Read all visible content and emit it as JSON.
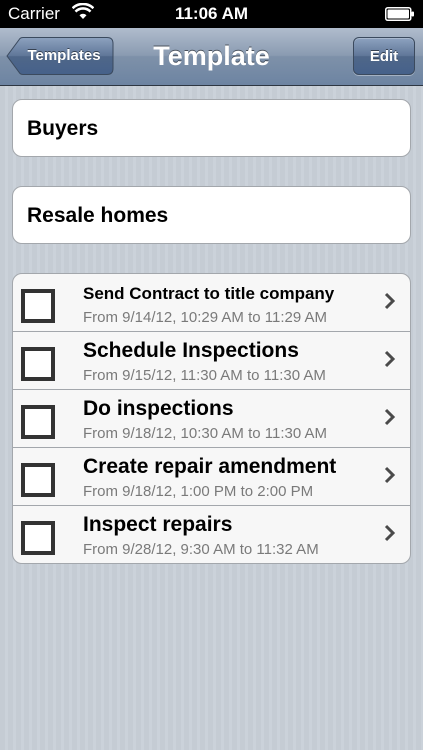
{
  "status_bar": {
    "carrier": "Carrier",
    "time": "11:06 AM",
    "wifi_icon": "wifi-icon",
    "battery_icon": "battery-icon"
  },
  "nav": {
    "back_label": "Templates",
    "title": "Template",
    "edit_label": "Edit"
  },
  "fields": {
    "name": "Buyers",
    "category": "Resale homes"
  },
  "tasks": [
    {
      "title": "Send Contract to title company",
      "subtitle": "From 9/14/12, 10:29 AM to 11:29 AM",
      "checked": false
    },
    {
      "title": "Schedule Inspections",
      "subtitle": "From 9/15/12, 11:30 AM to 11:30 AM",
      "checked": false
    },
    {
      "title": "Do inspections",
      "subtitle": "From 9/18/12, 10:30 AM to 11:30 AM",
      "checked": false
    },
    {
      "title": "Create repair amendment",
      "subtitle": "From 9/18/12, 1:00 PM to 2:00 PM",
      "checked": false
    },
    {
      "title": "Inspect repairs",
      "subtitle": "From 9/28/12, 9:30 AM to 11:32 AM",
      "checked": false
    }
  ],
  "colors": {
    "nav_bar": "#7e91a9",
    "background": "#c5ccd4",
    "subtitle_text": "#7a7a7a"
  }
}
